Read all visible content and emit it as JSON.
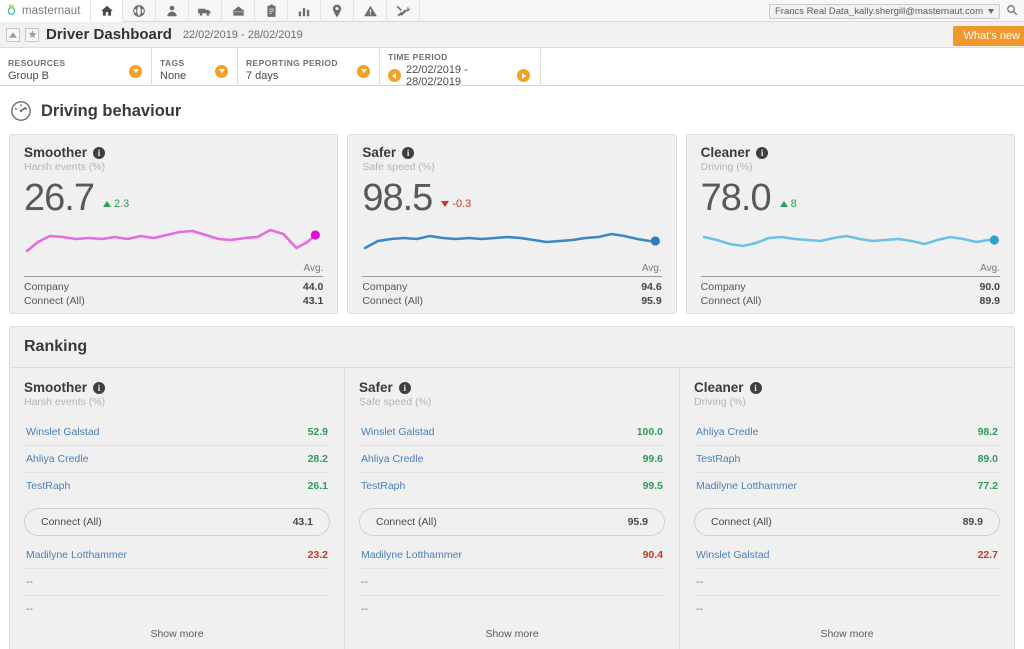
{
  "topbar": {
    "logo_text": "masternaut",
    "nav": [
      {
        "name": "home-icon",
        "label": "Home"
      },
      {
        "name": "globe-icon",
        "label": "Globe"
      },
      {
        "name": "person-icon",
        "label": "Drivers"
      },
      {
        "name": "truck-icon",
        "label": "Vehicles"
      },
      {
        "name": "envelope-icon",
        "label": "Messages"
      },
      {
        "name": "clipboard-icon",
        "label": "Jobs"
      },
      {
        "name": "bar-chart-icon",
        "label": "Reports"
      },
      {
        "name": "map-pin-icon",
        "label": "Places"
      },
      {
        "name": "warning-icon",
        "label": "Alerts"
      },
      {
        "name": "tools-icon",
        "label": "Admin"
      }
    ],
    "user_account": "Francs Real Data_kally.shergill@masternaut.com",
    "search_icon": "search-icon"
  },
  "header": {
    "collapse_icon": "chevron-up-icon",
    "favourite_icon": "star-icon",
    "title": "Driver Dashboard",
    "date_range": "22/02/2019 - 28/02/2019",
    "whats_new_label": "What's new"
  },
  "filters": [
    {
      "label": "RESOURCES",
      "value": "Group B",
      "control": "dropdown"
    },
    {
      "label": "TAGS",
      "value": "None",
      "control": "dropdown"
    },
    {
      "label": "REPORTING PERIOD",
      "value": "7 days",
      "control": "dropdown"
    },
    {
      "label": "TIME PERIOD",
      "value": "22/02/2019 - 28/02/2019",
      "control": "stepper"
    }
  ],
  "section": {
    "icon": "gauge-icon",
    "title": "Driving behaviour"
  },
  "colors": {
    "accent_orange": "#f0982d",
    "positive_green": "#2e9e5b",
    "negative_red": "#d0342c",
    "link_blue": "#4a7fbd",
    "smoother_line": "#e46ce0",
    "safer_line": "#3d87c8",
    "cleaner_line": "#6bc2e4",
    "card_bg": "#f0f0f0"
  },
  "cards": [
    {
      "title": "Smoother",
      "subtitle": "Harsh events (%)",
      "value": "26.7",
      "delta": "2.3",
      "delta_direction": "up",
      "avg_header": "Avg.",
      "rows": [
        {
          "label": "Company",
          "value": "44.0"
        },
        {
          "label": "Connect (All)",
          "value": "43.1"
        }
      ]
    },
    {
      "title": "Safer",
      "subtitle": "Safe speed (%)",
      "value": "98.5",
      "delta": "-0.3",
      "delta_direction": "down",
      "avg_header": "Avg.",
      "rows": [
        {
          "label": "Company",
          "value": "94.6"
        },
        {
          "label": "Connect (All)",
          "value": "95.9"
        }
      ]
    },
    {
      "title": "Cleaner",
      "subtitle": "Driving (%)",
      "value": "78.0",
      "delta": "8",
      "delta_direction": "up",
      "avg_header": "Avg.",
      "rows": [
        {
          "label": "Company",
          "value": "90.0"
        },
        {
          "label": "Connect (All)",
          "value": "89.9"
        }
      ]
    }
  ],
  "chart_data": [
    {
      "type": "line",
      "title": "Smoother",
      "ylabel": "Harsh events (%)",
      "series": [
        {
          "name": "Smoother",
          "color": "#e46ce0",
          "values": [
            22,
            33,
            36,
            32,
            35,
            33,
            36,
            34,
            32,
            36,
            34,
            37,
            40,
            41,
            36,
            32,
            31,
            33,
            34,
            41,
            37,
            22,
            28,
            36
          ]
        }
      ],
      "endpoint_marker": true,
      "grid": false,
      "legend": false
    },
    {
      "type": "line",
      "title": "Safer",
      "ylabel": "Safe speed (%)",
      "series": [
        {
          "name": "Safer",
          "color": "#3d87c8",
          "values": [
            24,
            33,
            35,
            36,
            35,
            38,
            36,
            35,
            36,
            35,
            36,
            37,
            36,
            34,
            32,
            33,
            34,
            36,
            37,
            40,
            38,
            35,
            33,
            33
          ]
        }
      ],
      "endpoint_marker": true,
      "grid": false,
      "legend": false
    },
    {
      "type": "line",
      "title": "Cleaner",
      "ylabel": "Driving (%)",
      "series": [
        {
          "name": "Cleaner",
          "color": "#6bc2e4",
          "values": [
            38,
            33,
            29,
            27,
            30,
            35,
            36,
            34,
            33,
            32,
            35,
            37,
            34,
            32,
            33,
            34,
            32,
            29,
            33,
            36,
            34,
            31,
            33,
            33
          ]
        }
      ],
      "endpoint_marker": true,
      "grid": false,
      "legend": false
    }
  ],
  "ranking": {
    "title": "Ranking",
    "show_more_label": "Show more",
    "columns": [
      {
        "title": "Smoother",
        "subtitle": "Harsh events (%)",
        "top": [
          {
            "name": "Winslet Galstad",
            "value": "52.9",
            "tone": "good"
          },
          {
            "name": "Ahliya Credle",
            "value": "28.2",
            "tone": "good"
          },
          {
            "name": "TestRaph",
            "value": "26.1",
            "tone": "good"
          }
        ],
        "connect": {
          "label": "Connect (All)",
          "value": "43.1"
        },
        "bottom": [
          {
            "name": "Madilyne Lotthammer",
            "value": "23.2",
            "tone": "bad"
          },
          {
            "name": "--",
            "value": "",
            "tone": "none"
          },
          {
            "name": "--",
            "value": "",
            "tone": "none"
          }
        ]
      },
      {
        "title": "Safer",
        "subtitle": "Safe speed (%)",
        "top": [
          {
            "name": "Winslet Galstad",
            "value": "100.0",
            "tone": "good"
          },
          {
            "name": "Ahliya Credle",
            "value": "99.6",
            "tone": "good"
          },
          {
            "name": "TestRaph",
            "value": "99.5",
            "tone": "good"
          }
        ],
        "connect": {
          "label": "Connect (All)",
          "value": "95.9"
        },
        "bottom": [
          {
            "name": "Madilyne Lotthammer",
            "value": "90.4",
            "tone": "bad"
          },
          {
            "name": "--",
            "value": "",
            "tone": "none"
          },
          {
            "name": "--",
            "value": "",
            "tone": "none"
          }
        ]
      },
      {
        "title": "Cleaner",
        "subtitle": "Driving (%)",
        "top": [
          {
            "name": "Ahliya Credle",
            "value": "98.2",
            "tone": "good"
          },
          {
            "name": "TestRaph",
            "value": "89.0",
            "tone": "good"
          },
          {
            "name": "Madilyne Lotthammer",
            "value": "77.2",
            "tone": "good"
          }
        ],
        "connect": {
          "label": "Connect (All)",
          "value": "89.9"
        },
        "bottom": [
          {
            "name": "Winslet Galstad",
            "value": "22.7",
            "tone": "bad"
          },
          {
            "name": "--",
            "value": "",
            "tone": "none"
          },
          {
            "name": "--",
            "value": "",
            "tone": "none"
          }
        ]
      }
    ]
  }
}
